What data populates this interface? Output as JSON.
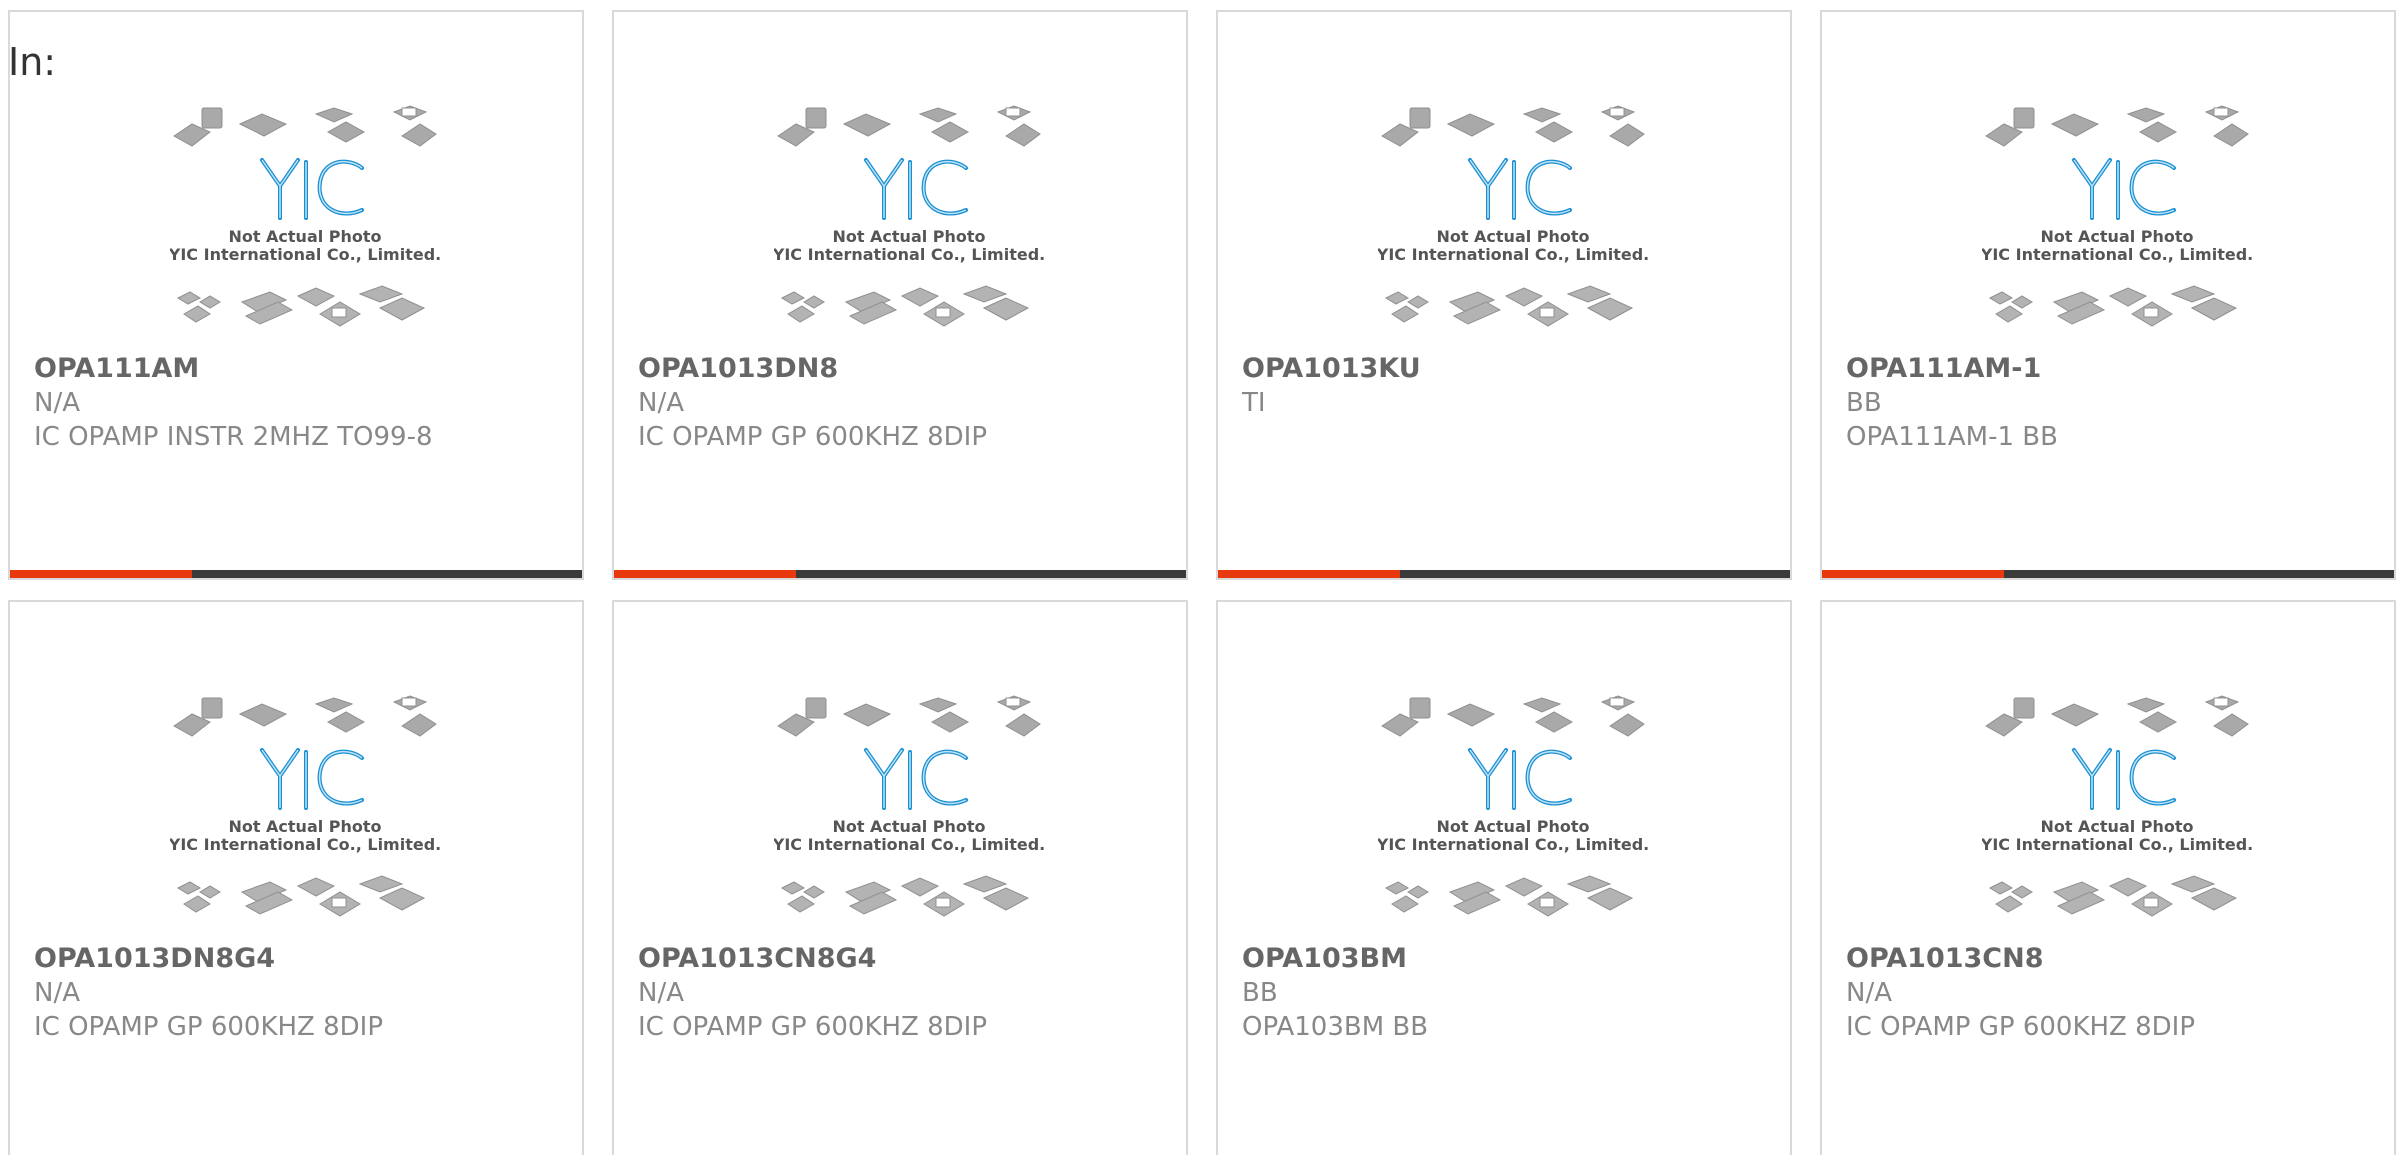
{
  "header": {
    "in_label": "In:"
  },
  "placeholder": {
    "line1": "Not Actual Photo",
    "line2": "YIC International Co., Limited.",
    "logo": "YIC"
  },
  "colors": {
    "accent": "#e8380d",
    "bar": "#3a3a3a",
    "border": "#d9d9d9",
    "logo_blue": "#1a8fd1"
  },
  "products": [
    {
      "part": "OPA111AM",
      "maker": "N/A",
      "desc": "IC OPAMP INSTR 2MHZ TO99-8"
    },
    {
      "part": "OPA1013DN8",
      "maker": "N/A",
      "desc": "IC OPAMP GP 600KHZ 8DIP"
    },
    {
      "part": "OPA1013KU",
      "maker": "TI",
      "desc": ""
    },
    {
      "part": "OPA111AM-1",
      "maker": "BB",
      "desc": "OPA111AM-1 BB"
    },
    {
      "part": "OPA1013DN8G4",
      "maker": "N/A",
      "desc": "IC OPAMP GP 600KHZ 8DIP"
    },
    {
      "part": "OPA1013CN8G4",
      "maker": "N/A",
      "desc": "IC OPAMP GP 600KHZ 8DIP"
    },
    {
      "part": "OPA103BM",
      "maker": "BB",
      "desc": "OPA103BM BB"
    },
    {
      "part": "OPA1013CN8",
      "maker": "N/A",
      "desc": "IC OPAMP GP 600KHZ 8DIP"
    }
  ]
}
